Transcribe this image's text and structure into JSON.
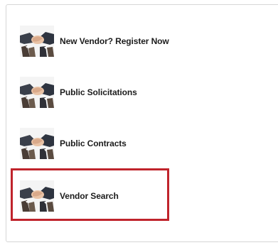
{
  "menu": {
    "items": [
      {
        "label": "New Vendor? Register Now",
        "icon": "handshake-icon"
      },
      {
        "label": "Public Solicitations",
        "icon": "handshake-icon"
      },
      {
        "label": "Public Contracts",
        "icon": "handshake-icon"
      },
      {
        "label": "Vendor Search",
        "icon": "handshake-icon"
      }
    ],
    "highlighted_index": 3
  },
  "colors": {
    "highlight_border": "#c0242c",
    "text": "#1c1c1c",
    "panel_border": "#d6d6d6"
  }
}
